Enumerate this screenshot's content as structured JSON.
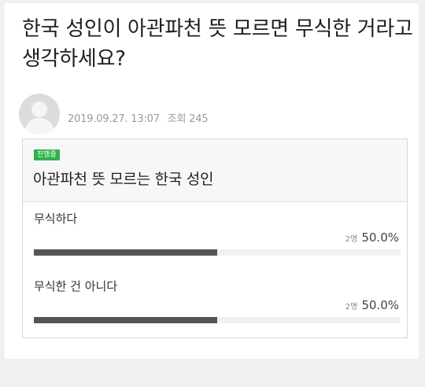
{
  "post": {
    "title": "한국 성인이 아관파천 뜻 모르면 무식한 거라고 생각하세요?",
    "date": "2019.09.27. 13:07",
    "views_label": "조회 245"
  },
  "poll": {
    "status_badge": "진행중",
    "question": "아관파천 뜻 모르는 한국 성인",
    "options": [
      {
        "label": "무식하다",
        "votes": "2명",
        "percent_text": "50.0%",
        "fraction": 0.5
      },
      {
        "label": "무식한 건 아니다",
        "votes": "2명",
        "percent_text": "50.0%",
        "fraction": 0.5
      }
    ]
  },
  "icons": {
    "avatar": "default-user-icon"
  },
  "colors": {
    "badge": "#2db34a",
    "bar_fill": "#555555",
    "bar_track": "#f1f1f1"
  }
}
